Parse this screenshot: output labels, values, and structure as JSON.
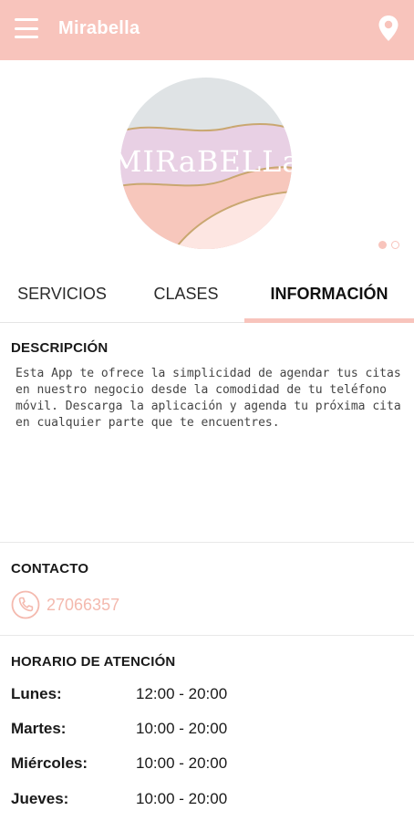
{
  "appbar": {
    "title": "Mirabella",
    "menu_icon": "menu-icon",
    "location_icon": "location-pin-icon",
    "background": "#f8c4bc"
  },
  "hero": {
    "logo_text": "MIRaBELLa",
    "carousel_total": 2,
    "carousel_active": 1
  },
  "tabs": [
    {
      "label": "SERVICIOS",
      "active": false
    },
    {
      "label": "CLASES",
      "active": false
    },
    {
      "label": "INFORMACIÓN",
      "active": true
    }
  ],
  "description": {
    "title": "DESCRIPCIÓN",
    "text": "Esta App te ofrece la simplicidad de agendar tus citas en nuestro negocio desde la comodidad de tu teléfono móvil. Descarga la aplicación y agenda tu próxima cita en cualquier parte que te encuentres."
  },
  "contact": {
    "title": "CONTACTO",
    "phone": "27066357",
    "phone_icon": "phone-icon"
  },
  "hours": {
    "title": "HORARIO DE ATENCIÓN",
    "rows": [
      {
        "day": "Lunes:",
        "time": "12:00 - 20:00"
      },
      {
        "day": "Martes:",
        "time": "10:00 - 20:00"
      },
      {
        "day": "Miércoles:",
        "time": "10:00 - 20:00"
      },
      {
        "day": "Jueves:",
        "time": "10:00 - 20:00"
      }
    ]
  },
  "colors": {
    "accent": "#f8c4bc",
    "phone_text": "#f4b9ae"
  }
}
